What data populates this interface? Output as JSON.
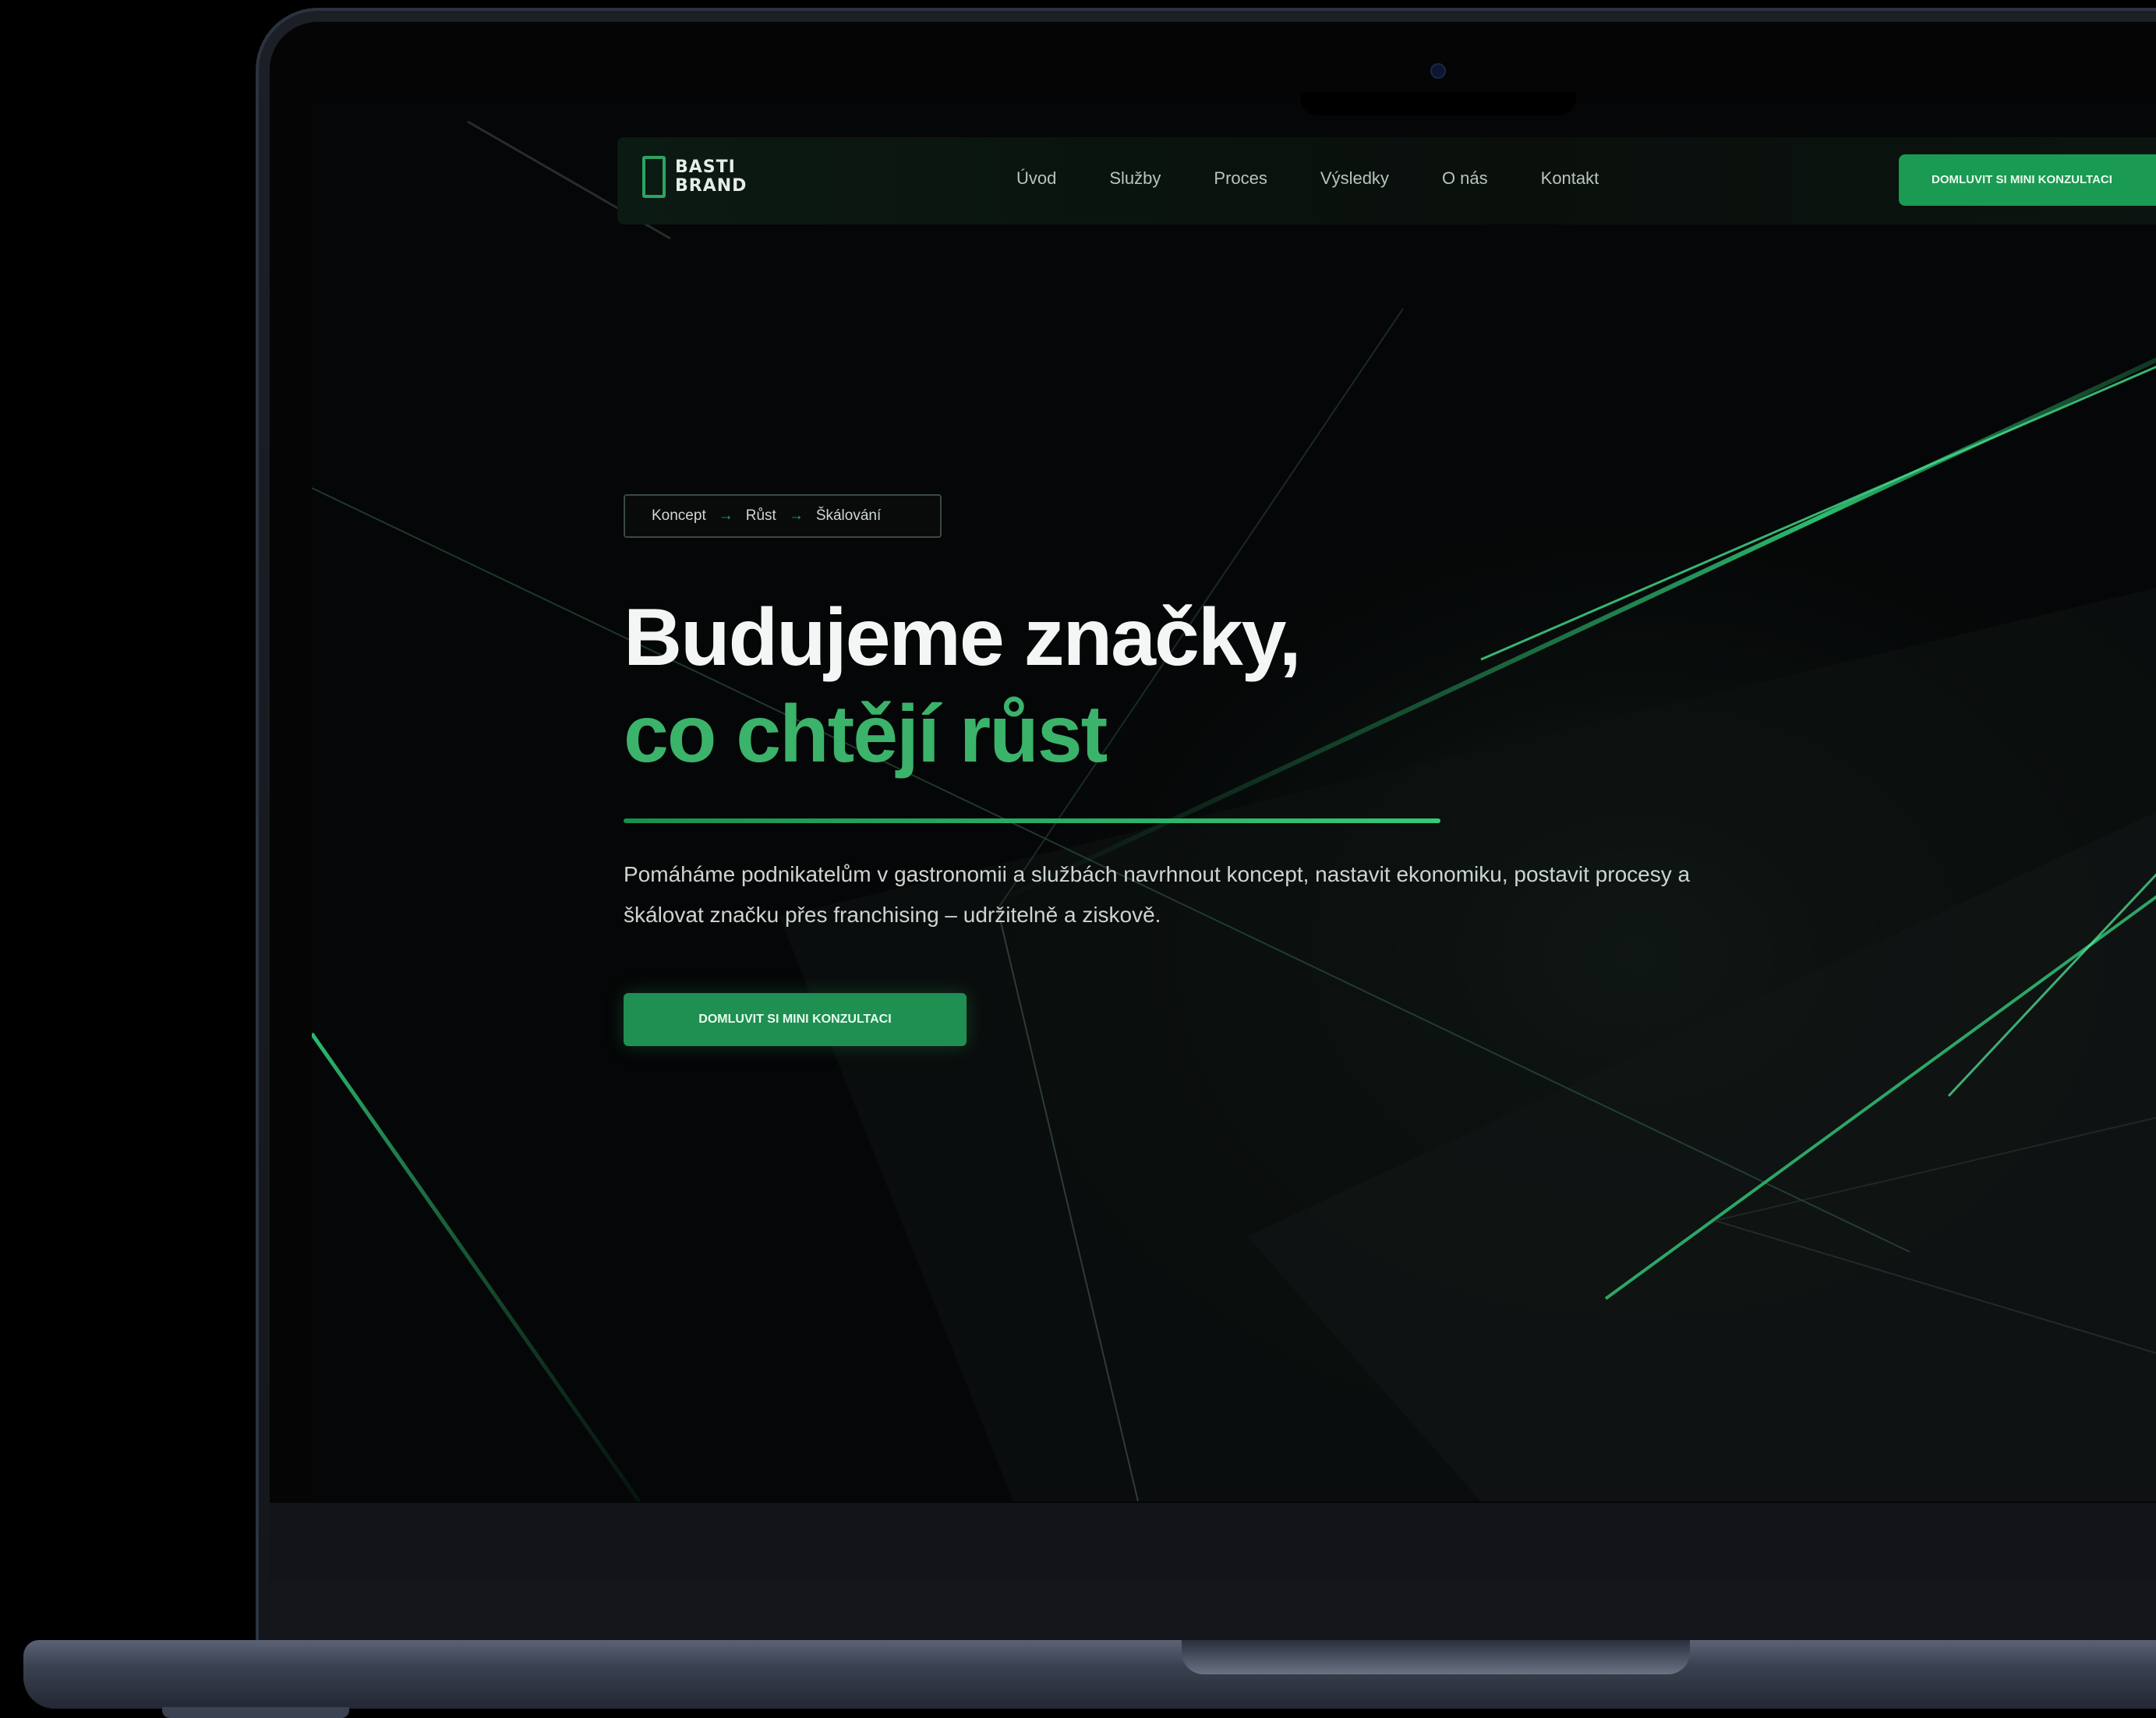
{
  "logo": {
    "line1": "BASTI",
    "line2": "BRAND"
  },
  "nav": {
    "items": [
      {
        "label": "Úvod"
      },
      {
        "label": "Služby"
      },
      {
        "label": "Proces"
      },
      {
        "label": "Výsledky"
      },
      {
        "label": "O nás"
      },
      {
        "label": "Kontakt"
      }
    ],
    "cta_label": "DOMLUVIT SI MINI KONZULTACI"
  },
  "hero": {
    "pill": {
      "step1": "Koncept",
      "step2": "Růst",
      "step3": "Škálování",
      "separator": "→"
    },
    "title_line1": "Budujeme značky,",
    "title_line2": "co chtějí růst",
    "description": "Pomáháme podnikatelům v gastronomii a službách navrhnout koncept, nastavit ekonomiku, postavit procesy a škálovat značku přes franchising – udržitelně a ziskově.",
    "cta_label": "DOMLUVIT SI MINI KONZULTACI"
  },
  "colors": {
    "accent": "#2ea363",
    "background": "#050607",
    "title": "#f4f6f5",
    "title_accent": "#3bb36a"
  }
}
